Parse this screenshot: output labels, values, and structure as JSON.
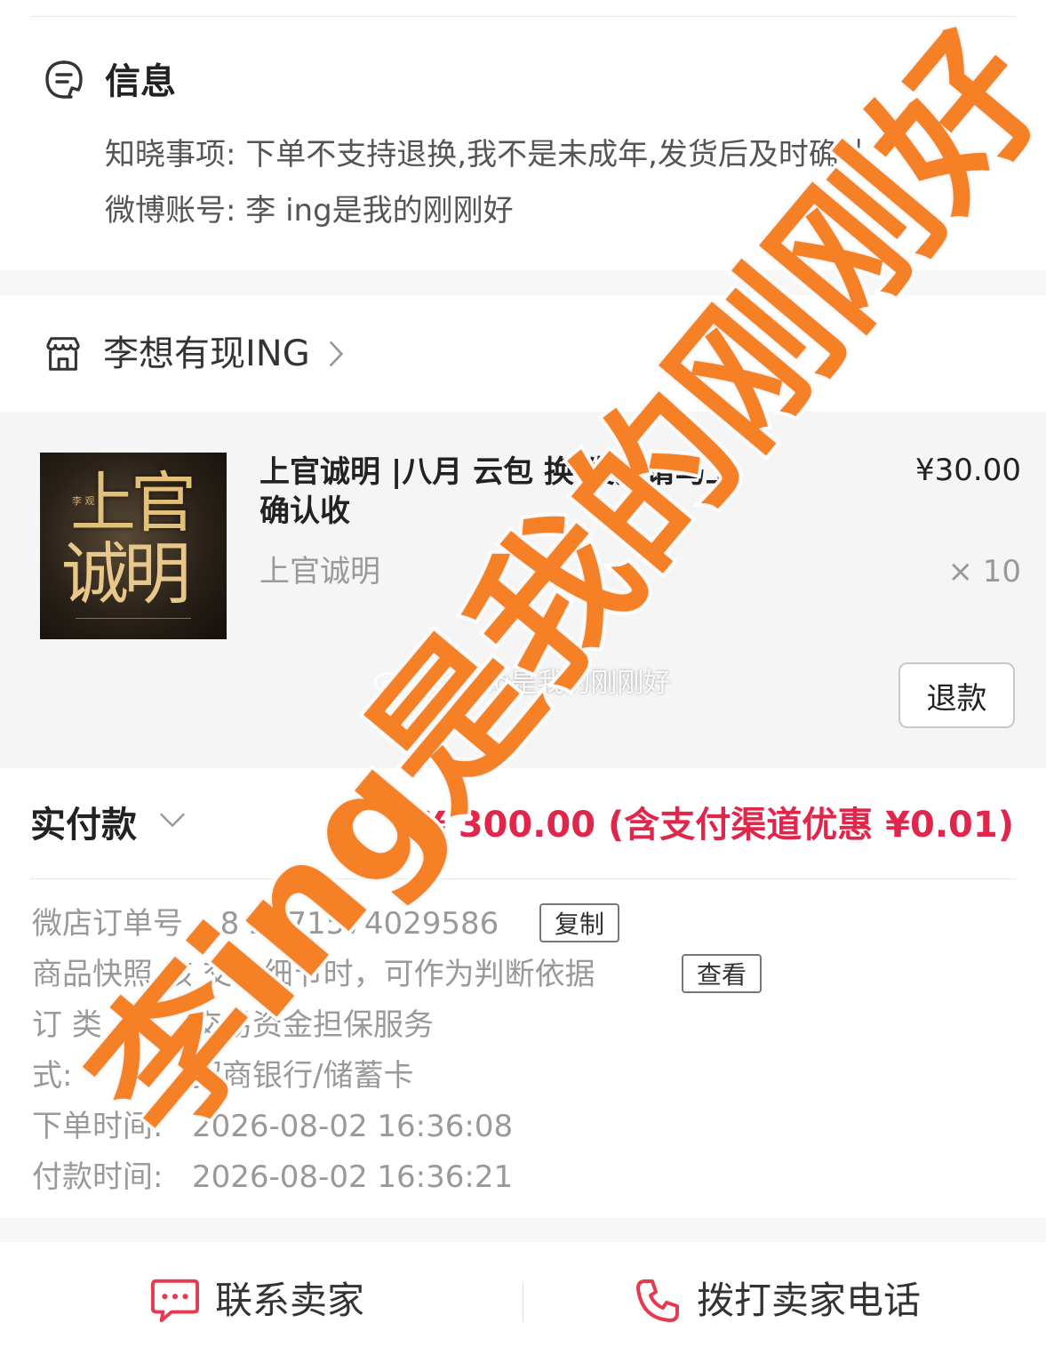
{
  "info": {
    "title": "信息",
    "notice": "知晓事项: 下单不支持退换,我不是未成年,发货后及时确认",
    "weibo": "微博账号: 李 ing是我的刚刚好"
  },
  "shop": {
    "name": "李想有现ING"
  },
  "product": {
    "title": "上官诚明 |八月 云包      换 发货请马上确认收",
    "variant": "上官诚明",
    "price": "¥30.00",
    "quantity": "× 10",
    "thumb_line1": "上官",
    "thumb_line2": "诚明",
    "refund_label": "退款"
  },
  "payment": {
    "paid_label": "实付款",
    "paid_amount": "¥ 300.00 (含支付渠道优惠 ¥0.01)",
    "order_no_label": "微店订单号",
    "order_no_value": "8  2271574029586",
    "copy_label": "复制",
    "snapshot_text": "商品快照   核   交易细节时，可作为判断依据",
    "view_label": "查看",
    "order_type_label": "订   类",
    "order_type_value": "交易资金担保服务",
    "pay_method_label": "    式:",
    "pay_method_value": "招商银行/储蓄卡",
    "order_time_label": "下单时间:",
    "order_time_value": "2026-08-02 16:36:08",
    "pay_time_label": "付款时间:",
    "pay_time_value": "2026-08-02 16:36:21"
  },
  "bottom": {
    "contact_label": "联系卖家",
    "call_label": "拨打卖家电话"
  },
  "watermark": {
    "small": "@李ing是我的刚刚好",
    "big": "李ing是我的刚刚好"
  },
  "colors": {
    "accent_red": "#e0264a",
    "watermark_orange": "#f58026"
  }
}
